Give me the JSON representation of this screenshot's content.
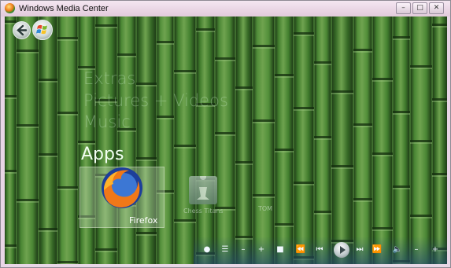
{
  "window": {
    "title": "Windows Media Center",
    "buttons": {
      "minimize": "–",
      "restore": "□",
      "close": "✕"
    }
  },
  "menu": {
    "extras": "Extras",
    "pictures": "Pictures + Videos",
    "music": "Music",
    "apps": "Apps"
  },
  "apps": {
    "items": [
      {
        "label": "Firefox",
        "icon": "firefox-icon"
      },
      {
        "label": "Chess Titans",
        "icon": "chess-icon"
      },
      {
        "label": "TOM",
        "icon": "tom-icon"
      }
    ]
  },
  "transport": {
    "record": "●",
    "guide": "☰",
    "ch_down": "–",
    "ch_up": "+",
    "stop": "■",
    "rewind": "⏪",
    "prev": "⏮",
    "next": "⏭",
    "ffwd": "⏩",
    "mute": "🔈",
    "vol_down": "–",
    "vol_up": "+"
  },
  "colors": {
    "bamboo": "#3f6e2e",
    "titlebar": "#e9d6e6",
    "text_active": "#f2fff2",
    "text_faded": "#c8ebc8"
  }
}
